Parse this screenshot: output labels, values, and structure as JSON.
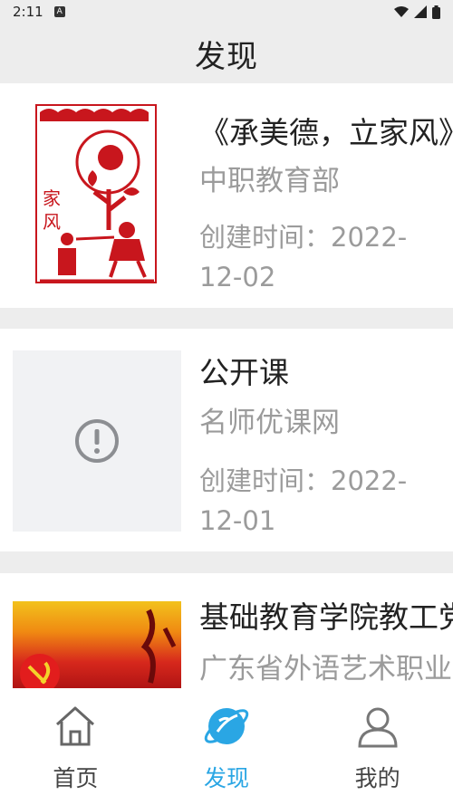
{
  "status_bar": {
    "time": "2:11",
    "notification_badge": "A"
  },
  "header": {
    "title": "发现"
  },
  "items": [
    {
      "title": "《承美德，立家风》",
      "source": "中职教育部",
      "created": "创建时间：2022-12-02",
      "thumb_icon": "papercut-image"
    },
    {
      "title": "公开课",
      "source": "名师优课网",
      "created": "创建时间：2022-12-01",
      "thumb_icon": "error-placeholder-icon"
    },
    {
      "title": "基础教育学院教工党支部",
      "source": "广东省外语艺术职业学院",
      "created": "",
      "thumb_icon": "party-banner-image"
    }
  ],
  "tabs": [
    {
      "label": "首页",
      "icon": "home-icon",
      "active": false
    },
    {
      "label": "发现",
      "icon": "discover-planet-icon",
      "active": true
    },
    {
      "label": "我的",
      "icon": "profile-icon",
      "active": false
    }
  ],
  "colors": {
    "accent": "#2aa6e4",
    "background": "#ededed",
    "muted": "#9b9b9b"
  }
}
